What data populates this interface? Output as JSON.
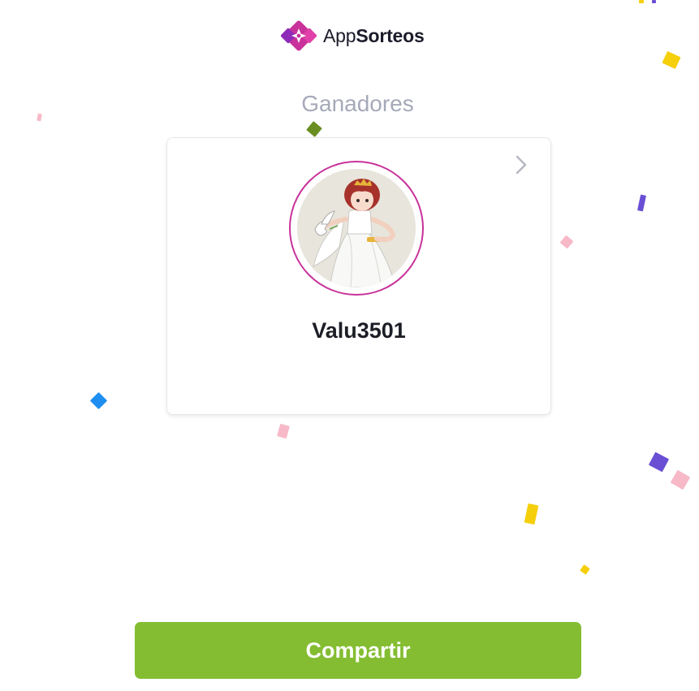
{
  "brand": {
    "name_prefix": "App",
    "name_suffix": "Sorteos",
    "logo_icon": "ticket-diamond-icon",
    "colors": {
      "logo_primary": "#c8329a",
      "logo_secondary": "#8e2bb8"
    }
  },
  "page": {
    "heading": "Ganadores"
  },
  "winner_card": {
    "username": "Valu3501",
    "avatar_alt": "Valu3501",
    "next_icon": "chevron-right-icon",
    "ring_color": "#c8329a"
  },
  "actions": {
    "share_label": "Compartir",
    "share_color": "#84bd31"
  },
  "confetti_colors": {
    "yellow": "#f5cf0a",
    "green": "#6b8e23",
    "pink": "#f7b9c7",
    "blue": "#1e8ff0",
    "purple": "#6a4fd4"
  }
}
